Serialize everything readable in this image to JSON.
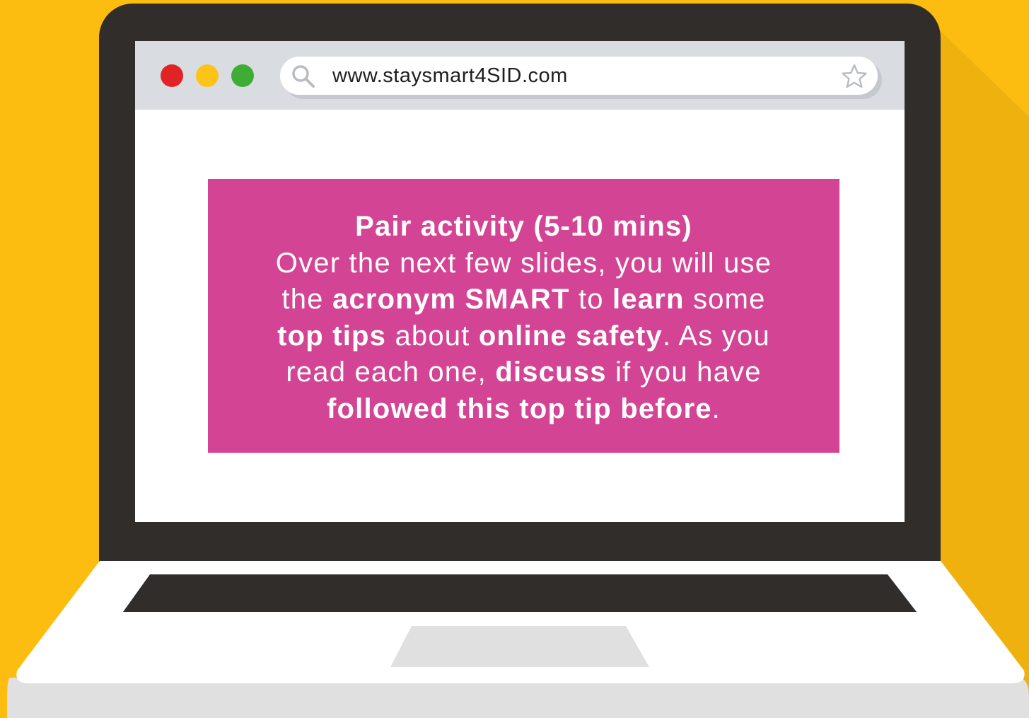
{
  "colors": {
    "background": "#fdbd10",
    "laptop_frame": "#302d2b",
    "browser_bar": "#d9dce0",
    "activity_box": "#d34594",
    "dot_red": "#e02424",
    "dot_yellow": "#fcc419",
    "dot_green": "#3fac36"
  },
  "browser": {
    "url": "www.staysmart4SID.com",
    "icons": {
      "search": "search-icon",
      "bookmark": "star-icon"
    }
  },
  "activity": {
    "title": "Pair activity (5-10 mins)",
    "line1": "Over the next few slides, you will use",
    "line2_a": "the ",
    "line2_b": "acronym SMART",
    "line2_c": " to ",
    "line2_d": "learn",
    "line2_e": " some",
    "line3_a": "top tips",
    "line3_b": " about ",
    "line3_c": "online safety",
    "line3_d": ". As you",
    "line4_a": "read each one, ",
    "line4_b": "discuss",
    "line4_c": " if you have",
    "line5_a": "followed this top tip before",
    "line5_b": "."
  }
}
